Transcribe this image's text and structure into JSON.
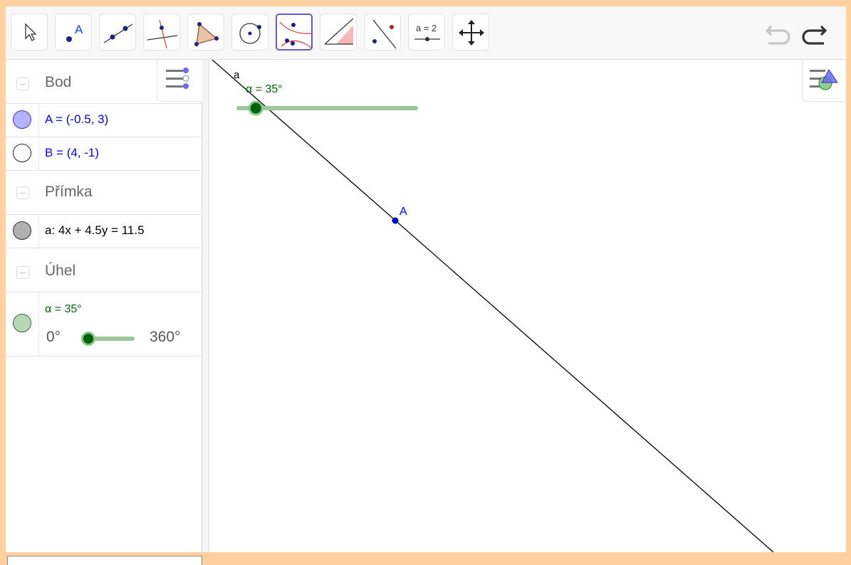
{
  "toolbar": {
    "tools": [
      {
        "name": "move-tool",
        "icon": "cursor-arrow-icon"
      },
      {
        "name": "point-tool",
        "icon": "point-icon",
        "label": "A"
      },
      {
        "name": "line-tool",
        "icon": "line-through-points-icon"
      },
      {
        "name": "perpendicular-line-tool",
        "icon": "perpendicular-line-icon"
      },
      {
        "name": "polygon-tool",
        "icon": "polygon-icon"
      },
      {
        "name": "circle-tool",
        "icon": "circle-center-point-icon"
      },
      {
        "name": "conic-tool",
        "icon": "hyperbola-icon",
        "active": true
      },
      {
        "name": "angle-tool",
        "icon": "angle-icon"
      },
      {
        "name": "reflect-tool",
        "icon": "reflect-about-line-icon"
      },
      {
        "name": "slider-tool",
        "icon": "slider-icon",
        "label": "a = 2"
      },
      {
        "name": "move-graphics-tool",
        "icon": "move-graphics-view-icon"
      }
    ],
    "undo_icon": "undo-icon",
    "redo_icon": "redo-icon"
  },
  "algebra": {
    "categories": [
      {
        "label": "Bod"
      },
      {
        "label": "Přímka"
      },
      {
        "label": "Úhel"
      }
    ],
    "items": [
      {
        "expr": "A = (-0.5, 3)",
        "color": "#0000ff",
        "marble": "#b3b3ff"
      },
      {
        "expr": "B = (4, -1)",
        "color": "#0000ff",
        "marble": "#ffffff"
      },
      {
        "expr": "a: 4x + 4.5y = 11.5",
        "color": "#000000",
        "marble": "#b0b0b0"
      },
      {
        "expr": "α = 35°",
        "color": "#006400",
        "marble": "#b7d7b7"
      }
    ],
    "slider": {
      "min": "0°",
      "max": "360°",
      "value": 35,
      "range": [
        0,
        360
      ]
    }
  },
  "graphics": {
    "line_label": "a",
    "point_label": "A",
    "slider_caption": "α = 35°",
    "slider_value": 35,
    "slider_range": [
      0,
      360
    ]
  },
  "colors": {
    "accent": "#6557d2",
    "slider_green": "#9bc79b",
    "slider_knob": "#006400",
    "point_blue": "#0000ff",
    "border_orange": "#ffd19e"
  }
}
